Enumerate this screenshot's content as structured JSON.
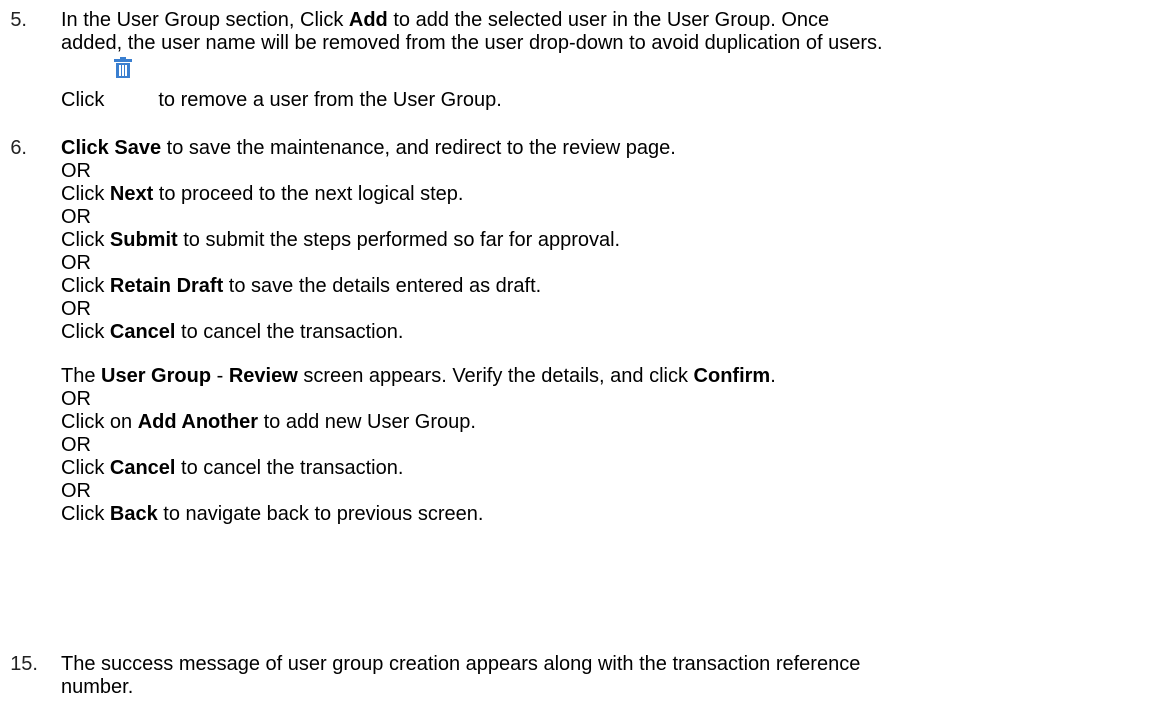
{
  "steps": [
    {
      "number": "5.",
      "line1": {
        "pre": "In the User Group section, Click ",
        "bold": "Add",
        "post": " to add the selected user in the User Group. Once"
      },
      "line2": "added, the user name will be removed from the user drop-down to avoid duplication of users.",
      "line3": {
        "pre": "Click",
        "post": "to remove a user from the User Group."
      }
    },
    {
      "number": "6.",
      "lines": [
        {
          "bold": "Click Save",
          "post": " to save the maintenance, and redirect to the review page."
        },
        {
          "plain": "OR"
        },
        {
          "pre": "Click ",
          "bold": "Next",
          "post": " to proceed to the next logical step."
        },
        {
          "plain": "OR"
        },
        {
          "pre": "Click ",
          "bold": "Submit",
          "post": " to submit the steps performed so far for approval."
        },
        {
          "plain": "OR"
        },
        {
          "pre": "Click ",
          "bold": "Retain Draft",
          "post": " to save the details entered as draft."
        },
        {
          "plain": "OR"
        },
        {
          "pre": "Click ",
          "bold": "Cancel",
          "post": " to cancel the transaction."
        }
      ],
      "review_lines": [
        {
          "pre": "The ",
          "bold": "User Group",
          "mid": " - ",
          "bold2": "Review",
          "post": " screen appears. Verify the details, and click ",
          "bold3": "Confirm",
          "end": "."
        },
        {
          "plain": "OR"
        },
        {
          "pre": "Click on ",
          "bold": "Add Another",
          "post": " to add new User Group."
        },
        {
          "plain": "OR"
        },
        {
          "pre": "Click ",
          "bold": "Cancel",
          "post": " to cancel the transaction."
        },
        {
          "plain": "OR"
        },
        {
          "pre": "Click ",
          "bold": "Back",
          "post": " to navigate back to previous screen."
        }
      ]
    },
    {
      "number": "15.",
      "line1": "The success message of user group creation appears along with the transaction reference",
      "line2": "number."
    }
  ],
  "icons": {
    "delete": "trash-icon",
    "delete_color": "#3a7fd0"
  }
}
